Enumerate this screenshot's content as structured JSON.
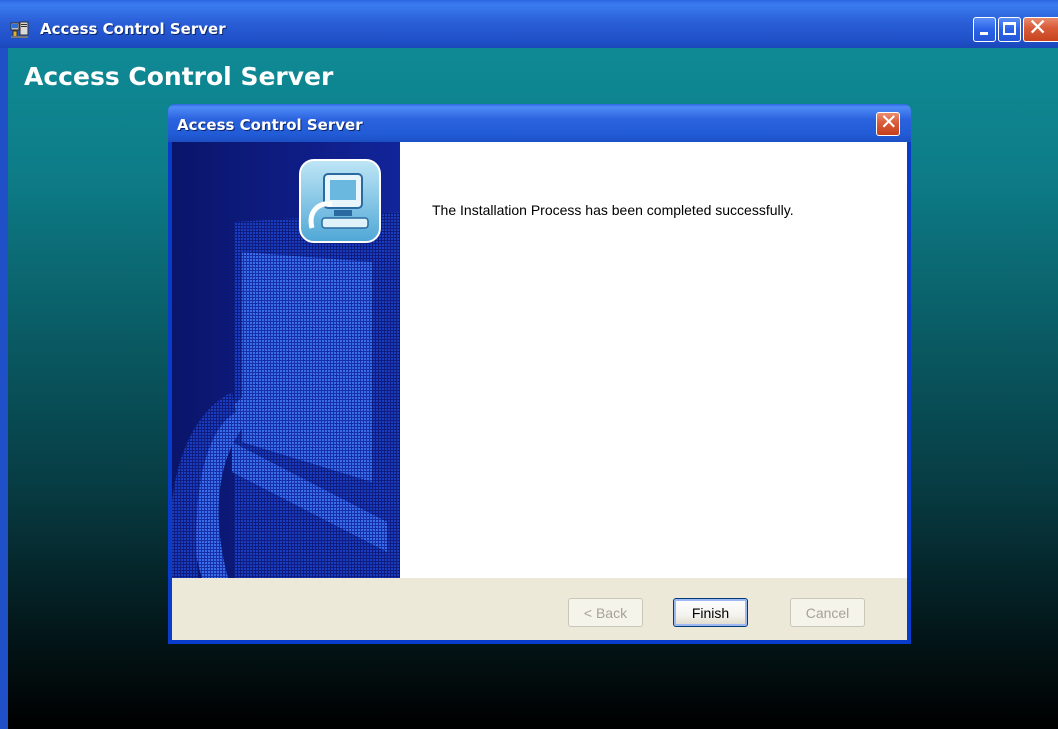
{
  "window": {
    "title": "Access Control Server",
    "heading": "Access Control Server"
  },
  "dialog": {
    "title": "Access Control Server",
    "message": "The Installation Process has been completed successfully.",
    "buttons": {
      "back": "< Back",
      "finish": "Finish",
      "cancel": "Cancel"
    },
    "button_states": {
      "back": "disabled",
      "finish": "default",
      "cancel": "disabled"
    }
  },
  "icons": {
    "app": "installer-app-icon",
    "wizard": "computer-setup-icon",
    "close": "close-icon",
    "minimize": "minimize-icon",
    "maximize": "maximize-icon"
  },
  "colors": {
    "titlebar_blue": "#2a5fd8",
    "close_red": "#d85b38",
    "desktop_teal": "#0d7d88",
    "dialog_face": "#ece9d8"
  }
}
